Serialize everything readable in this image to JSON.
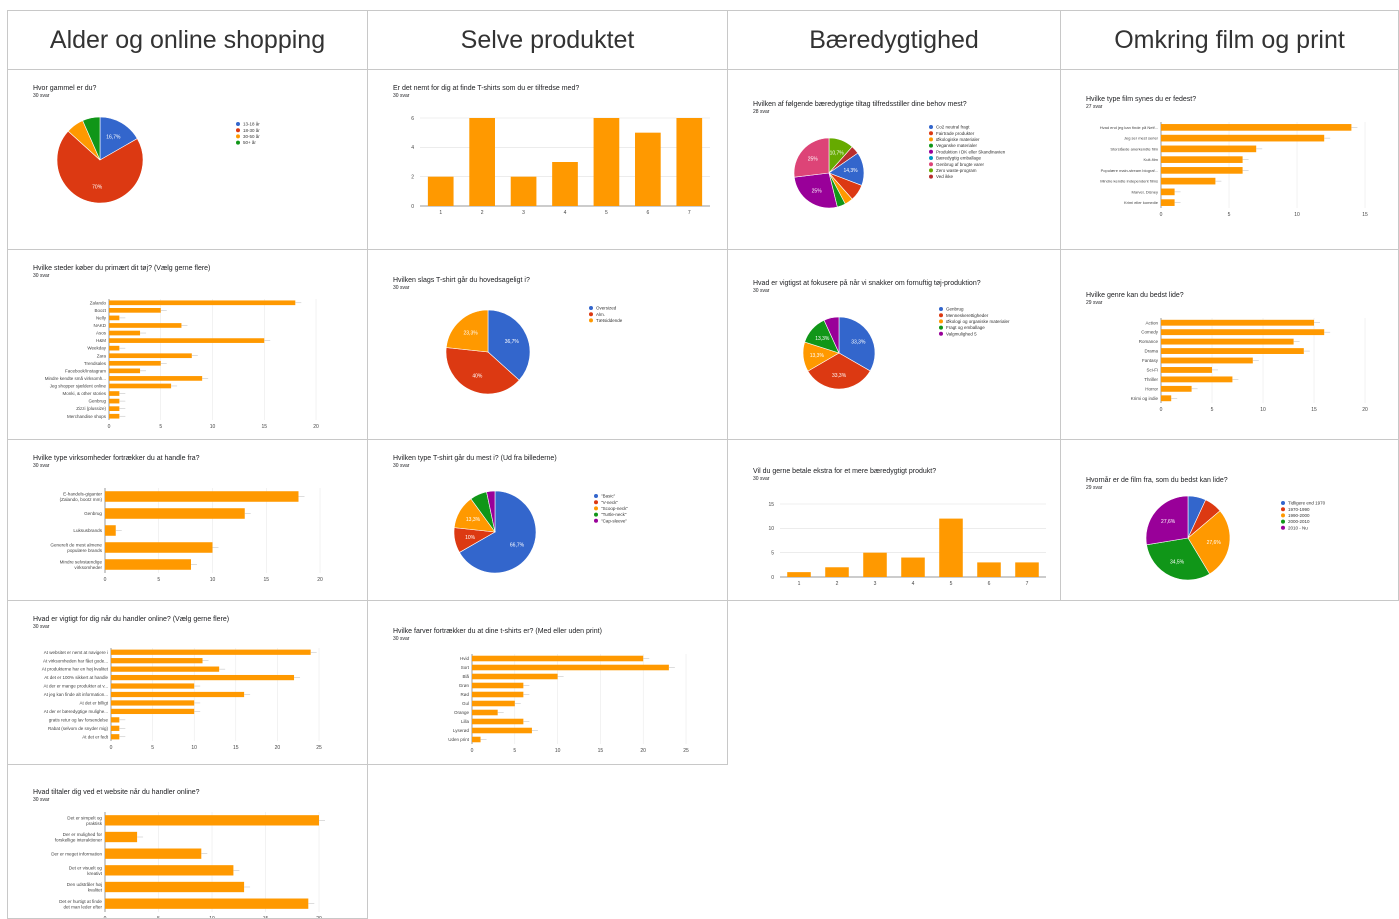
{
  "headers": [
    "Alder og online shopping",
    "Selve produktet",
    "Bæredygtighed",
    "Omkring film og print"
  ],
  "chart_data": [
    {
      "id": "c1",
      "type": "pie",
      "title": "Hvor gammel er du?",
      "subtitle": "30 svar",
      "categories": [
        "13-18 år",
        "18-30 år",
        "30-50 år",
        "50+ år"
      ],
      "values": [
        16.7,
        70,
        6.7,
        6.6
      ],
      "labels": [
        "16,7%",
        "70%",
        "",
        ""
      ],
      "colors": [
        "#3366cc",
        "#dc3912",
        "#ff9900",
        "#109618"
      ],
      "legend": "right"
    },
    {
      "id": "c2",
      "type": "bar",
      "title": "Er det nemt for dig at finde T-shirts som du er tilfredse med?",
      "subtitle": "30 svar",
      "categories": [
        "1",
        "2",
        "3",
        "4",
        "5",
        "6",
        "7"
      ],
      "values": [
        2,
        6,
        2,
        3,
        6,
        5,
        6
      ],
      "ylim": [
        0,
        6
      ],
      "yticks": [
        0,
        2,
        4,
        6
      ],
      "color": "#ff9900"
    },
    {
      "id": "c3",
      "type": "pie",
      "title": "Hvilken af følgende bæredygtige tiltag tilfredsstiller dine behov mest?",
      "subtitle": "28 svar",
      "categories": [
        "Co2 neutral fragt",
        "Fairtrade produkter",
        "Økologiske materialer",
        "Veganske materialer",
        "Produktion i DK eller Skandinavien",
        "Bæredygtig emballage",
        "Genbrug af brugte varer",
        "Zero waste-program",
        "Ved ikke"
      ],
      "values": [
        14.3,
        7.1,
        3.6,
        3.6,
        25,
        0,
        25,
        10.7,
        3.6
      ],
      "labels": [
        "14,3%",
        "",
        "",
        "",
        "25%",
        "",
        "25%",
        "10,7%",
        ""
      ],
      "colors": [
        "#3366cc",
        "#dc3912",
        "#ff9900",
        "#109618",
        "#990099",
        "#0099c6",
        "#dd4477",
        "#66aa00",
        "#b82e2e"
      ],
      "drawOrder": [
        7,
        8,
        0,
        1,
        2,
        3,
        4,
        5,
        6
      ],
      "legend": "right"
    },
    {
      "id": "c4",
      "type": "hbar",
      "title": "Hvilke type film synes du er fedest?",
      "subtitle": "27 svar",
      "categories": [
        "Hvad end jeg kan finde på Netf...",
        "Jeg ser mest serier",
        "Storslåede anerkendte film",
        "Kult-film",
        "Populære main-stream biograf...",
        "Mindre kendte independent films",
        "Marvel, Disney",
        "Krimi eller komedie"
      ],
      "values": [
        14,
        12,
        7,
        6,
        6,
        4,
        1,
        1
      ],
      "xlim": [
        0,
        15
      ],
      "xticks": [
        0,
        5,
        10,
        15
      ],
      "color": "#ff9900"
    },
    {
      "id": "c5",
      "type": "hbar",
      "title": "Hvilke steder køber du primært dit tøj? (Vælg gerne flere)",
      "subtitle": "30 svar",
      "categories": [
        "Zalando",
        "Boozt",
        "Nelly",
        "NAKD",
        "Asos",
        "H&M",
        "Weekday",
        "Zara",
        "Trendsales",
        "Facebook/Instagram",
        "Mindre kendte små virksomh...",
        "Jeg shopper sjældent online",
        "Monki, & other stories",
        "Genbrug",
        "Zizzi (plussize)",
        "Merchandise shops"
      ],
      "values": [
        18,
        5,
        1,
        7,
        3,
        15,
        1,
        8,
        5,
        3,
        9,
        6,
        1,
        1,
        1,
        1
      ],
      "xlim": [
        0,
        20
      ],
      "xticks": [
        0,
        5,
        10,
        15,
        20
      ],
      "color": "#ff9900"
    },
    {
      "id": "c6",
      "type": "pie",
      "title": "Hvilken slags T-shirt går du hovedsageligt i?",
      "subtitle": "30 svar",
      "categories": [
        "Oversized",
        "Alm.",
        "Tætsiddende"
      ],
      "values": [
        36.7,
        40,
        23.3
      ],
      "labels": [
        "36,7%",
        "40%",
        "23,3%"
      ],
      "colors": [
        "#3366cc",
        "#dc3912",
        "#ff9900"
      ],
      "legend": "right"
    },
    {
      "id": "c7",
      "type": "pie",
      "title": "Hvad er vigtigst at fokusere på når vi snakker om fornuftig tøj-produktion?",
      "subtitle": "30 svar",
      "categories": [
        "Genbrug",
        "Menneskerettigheder",
        "Økologi og organiske materialer",
        "Fragt og emballage",
        "Valgmulighed 5"
      ],
      "values": [
        33.3,
        33.3,
        13.3,
        13.3,
        6.8
      ],
      "labels": [
        "33,3%",
        "33,3%",
        "13,3%",
        "13,3%",
        ""
      ],
      "colors": [
        "#3366cc",
        "#dc3912",
        "#ff9900",
        "#109618",
        "#990099"
      ],
      "legend": "right"
    },
    {
      "id": "c8",
      "type": "hbar",
      "title": "Hvilke genre kan du bedst lide?",
      "subtitle": "29 svar",
      "categories": [
        "Action",
        "Comedy",
        "Romance",
        "Drama",
        "Fantasy",
        "Sci-Fi",
        "Thriller",
        "Horror",
        "Krimi og indie"
      ],
      "values": [
        15,
        16,
        13,
        14,
        9,
        5,
        7,
        3,
        1
      ],
      "xlim": [
        0,
        20
      ],
      "xticks": [
        0,
        5,
        10,
        15,
        20
      ],
      "color": "#ff9900"
    },
    {
      "id": "c9",
      "type": "hbar",
      "title": "Hvilke type virksomheder fortrækker du at handle fra?",
      "subtitle": "30 svar",
      "categories": [
        "E-handels-giganter (Zalando, bootz mm)",
        "Genbrug",
        "Luksusbrands",
        "Generelt de mest almene populære brands",
        "Mindre selvstændige virksomheder"
      ],
      "values": [
        18,
        13,
        1,
        10,
        8
      ],
      "xlim": [
        0,
        20
      ],
      "xticks": [
        0,
        5,
        10,
        15,
        20
      ],
      "color": "#ff9900"
    },
    {
      "id": "c10",
      "type": "pie",
      "title": "Hvilken type T-shirt går du mest i? (Ud fra billederne)",
      "subtitle": "30 svar",
      "categories": [
        "\"Basic\"",
        "\"V-neck\"",
        "\"Scoop-neck\"",
        "\"Turtle-neck\"",
        "\"Cap-sleeve\""
      ],
      "values": [
        66.7,
        10,
        13.3,
        6.7,
        3.3
      ],
      "labels": [
        "66,7%",
        "10%",
        "13,3%",
        "",
        ""
      ],
      "colors": [
        "#3366cc",
        "#dc3912",
        "#ff9900",
        "#109618",
        "#990099"
      ],
      "legend": "right"
    },
    {
      "id": "c11",
      "type": "bar",
      "title": "Vil du gerne betale ekstra for et mere bæredygtigt produkt?",
      "subtitle": "30 svar",
      "categories": [
        "1",
        "2",
        "3",
        "4",
        "5",
        "6",
        "7"
      ],
      "values": [
        1,
        2,
        5,
        4,
        12,
        3,
        3
      ],
      "ylim": [
        0,
        15
      ],
      "yticks": [
        0,
        5,
        10,
        15
      ],
      "color": "#ff9900"
    },
    {
      "id": "c12",
      "type": "pie",
      "title": "Hvornår er de film fra, som du bedst kan lide?",
      "subtitle": "29 svar",
      "categories": [
        "Tidligere end 1970",
        "1970-1990",
        "1990-2000",
        "2000-2010",
        "2010 - Nu"
      ],
      "values": [
        6.9,
        6.9,
        27.6,
        31.0,
        27.6
      ],
      "labels": [
        "",
        "",
        "27,6%",
        "34,5%",
        "27,6%"
      ],
      "colors": [
        "#3366cc",
        "#dc3912",
        "#ff9900",
        "#109618",
        "#990099"
      ],
      "legend": "right"
    },
    {
      "id": "c13",
      "type": "hbar",
      "title": "Hvad er vigtigt for dig når du handler online? (Vælg gerne flere)",
      "subtitle": "30 svar",
      "categories": [
        "At websitet er nemt at navigere i",
        "At virksomheden har fået gode...",
        "At produkterne har en høj kvalitet",
        "At det er 100% sikkert at handle",
        "At der er mange produkter at v...",
        "At jeg kan finde alt information...",
        "At det er billigt",
        "At der er bæredygtige mulighe...",
        "gratis retur og lav forsendelse",
        "Rabat (selvom de snyder mig)",
        "At det er fedt"
      ],
      "values": [
        24,
        11,
        13,
        22,
        10,
        16,
        10,
        10,
        1,
        1,
        1
      ],
      "xlim": [
        0,
        25
      ],
      "xticks": [
        0,
        5,
        10,
        15,
        20,
        25
      ],
      "color": "#ff9900"
    },
    {
      "id": "c14",
      "type": "hbar",
      "title": "Hvilke farver fortrækker du at dine t-shirts er? (Med eller uden print)",
      "subtitle": "30 svar",
      "categories": [
        "Hvid",
        "Sort",
        "Blå",
        "Grøn",
        "Rød",
        "Gul",
        "Orange",
        "Lilla",
        "Lyserød",
        "Uden print"
      ],
      "values": [
        20,
        23,
        10,
        6,
        6,
        5,
        3,
        6,
        7,
        1
      ],
      "xlim": [
        0,
        25
      ],
      "xticks": [
        0,
        5,
        10,
        15,
        20,
        25
      ],
      "color": "#ff9900"
    },
    {
      "id": "c15",
      "type": "hbar",
      "title": "Hvad tiltaler dig ved et website når du handler online?",
      "subtitle": "30 svar",
      "categories": [
        "Det er simpelt og praktisk",
        "Der er mulighed for forskellige interaktioner",
        "Der er meget information",
        "Det er visuelt og kreativt",
        "Den udstråler høj kvalitet",
        "Det er hurtigt at finde det man leder efter"
      ],
      "values": [
        20,
        3,
        9,
        12,
        13,
        19
      ],
      "xlim": [
        0,
        20
      ],
      "xticks": [
        0,
        5,
        10,
        15,
        20
      ],
      "color": "#ff9900"
    }
  ]
}
